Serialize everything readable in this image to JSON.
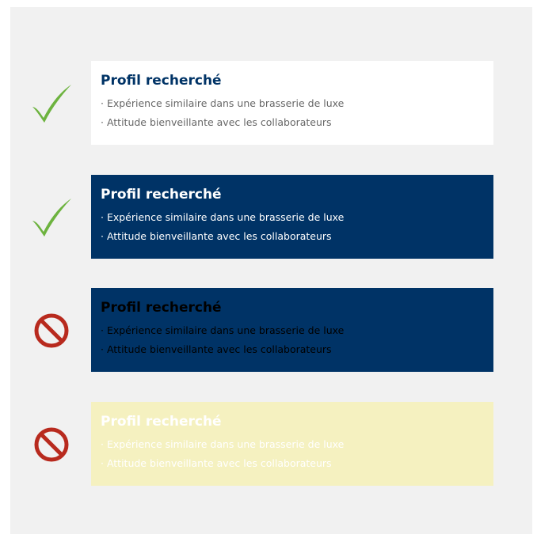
{
  "colors": {
    "panel_background": "#f1f1f1",
    "navy": "#003366",
    "grey_text": "#666666",
    "pale_yellow": "#f5f1c0",
    "check_green": "#6db33f",
    "prohibit_red": "#b82a1e"
  },
  "examples": [
    {
      "indicator_icon": "checkmark-icon",
      "title": "Profil recherché",
      "lines": [
        "· Expérience similaire dans une brasserie de luxe",
        "· Attitude bienveillante avec les collaborateurs"
      ]
    },
    {
      "indicator_icon": "checkmark-icon",
      "title": "Profil recherché",
      "lines": [
        "· Expérience similaire dans une brasserie de luxe",
        "· Attitude bienveillante avec les collaborateurs"
      ]
    },
    {
      "indicator_icon": "prohibited-icon",
      "title": "Profil recherché",
      "lines": [
        "· Expérience similaire dans une brasserie de luxe",
        "· Attitude bienveillante avec les collaborateurs"
      ]
    },
    {
      "indicator_icon": "prohibited-icon",
      "title": "Profil recherché",
      "lines": [
        "· Expérience similaire dans une brasserie de luxe",
        "· Attitude bienveillante avec les collaborateurs"
      ]
    }
  ]
}
